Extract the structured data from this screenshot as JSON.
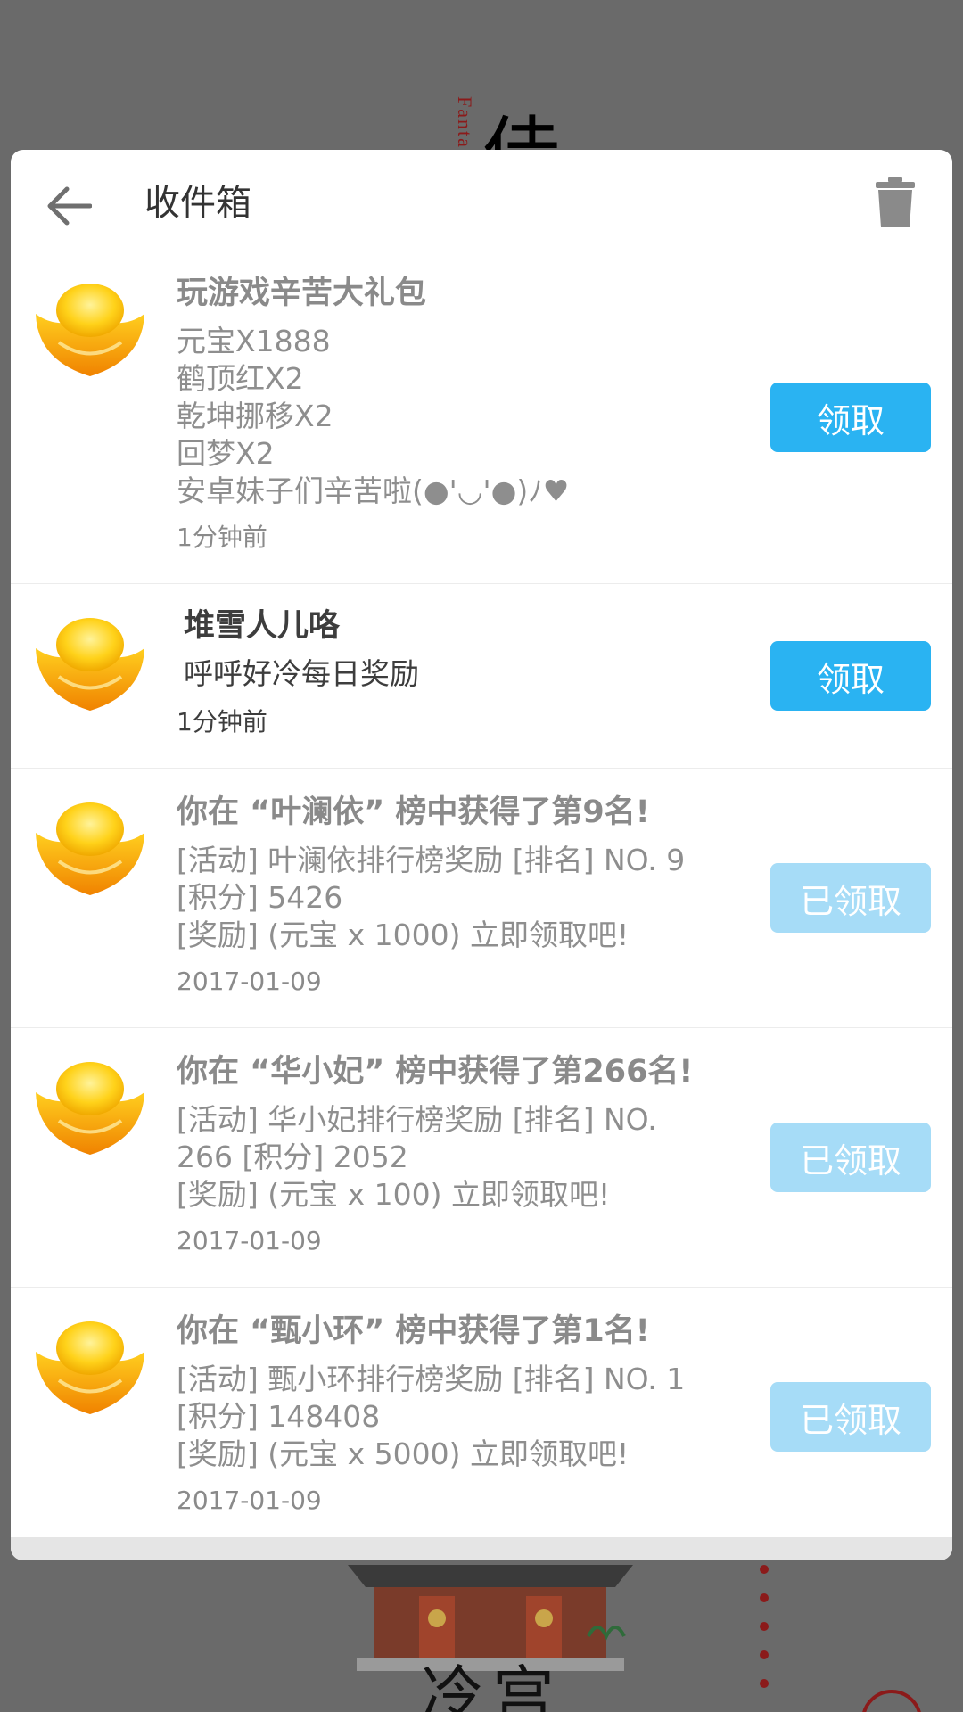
{
  "background": {
    "fantasy_text": "Fanta",
    "big_char": "佳",
    "palace_title": "冷宫",
    "palace_sign": "宫"
  },
  "dialog": {
    "title": "收件箱",
    "back_icon": "arrow-left-icon",
    "trash_icon": "trash-icon"
  },
  "mails": [
    {
      "icon": "gold-ingot-icon",
      "title": "玩游戏辛苦大礼包",
      "body": "元宝X1888\n鹤顶红X2\n乾坤挪移X2\n回梦X2\n安卓妹子们辛苦啦(●'◡'●)ﾉ♥",
      "time": "1分钟前",
      "button": "领取",
      "claimed": false
    },
    {
      "icon": "gold-ingot-icon",
      "title": "堆雪人儿咯",
      "body": "呼呼好冷每日奖励",
      "time": "1分钟前",
      "button": "领取",
      "claimed": false
    },
    {
      "icon": "gold-ingot-icon",
      "title": "你在 “叶澜依” 榜中获得了第9名!",
      "body": "[活动] 叶澜依排行榜奖励 [排名] NO. 9\n[积分] 5426\n[奖励] (元宝 x 1000) 立即领取吧!",
      "time": "2017-01-09",
      "button": "已领取",
      "claimed": true
    },
    {
      "icon": "gold-ingot-icon",
      "title": "你在 “华小妃” 榜中获得了第266名!",
      "body": "[活动] 华小妃排行榜奖励 [排名] NO.\n266 [积分] 2052\n[奖励] (元宝 x 100) 立即领取吧!",
      "time": "2017-01-09",
      "button": "已领取",
      "claimed": true
    },
    {
      "icon": "gold-ingot-icon",
      "title": "你在 “甄小环” 榜中获得了第1名!",
      "body": "[活动] 甄小环排行榜奖励 [排名] NO. 1\n[积分] 148408\n[奖励] (元宝 x 5000) 立即领取吧!",
      "time": "2017-01-09",
      "button": "已领取",
      "claimed": true
    }
  ],
  "colors": {
    "accent": "#2ab3f2",
    "accent_disabled": "#a6dcf7",
    "overlay": "#5e5e5e"
  }
}
